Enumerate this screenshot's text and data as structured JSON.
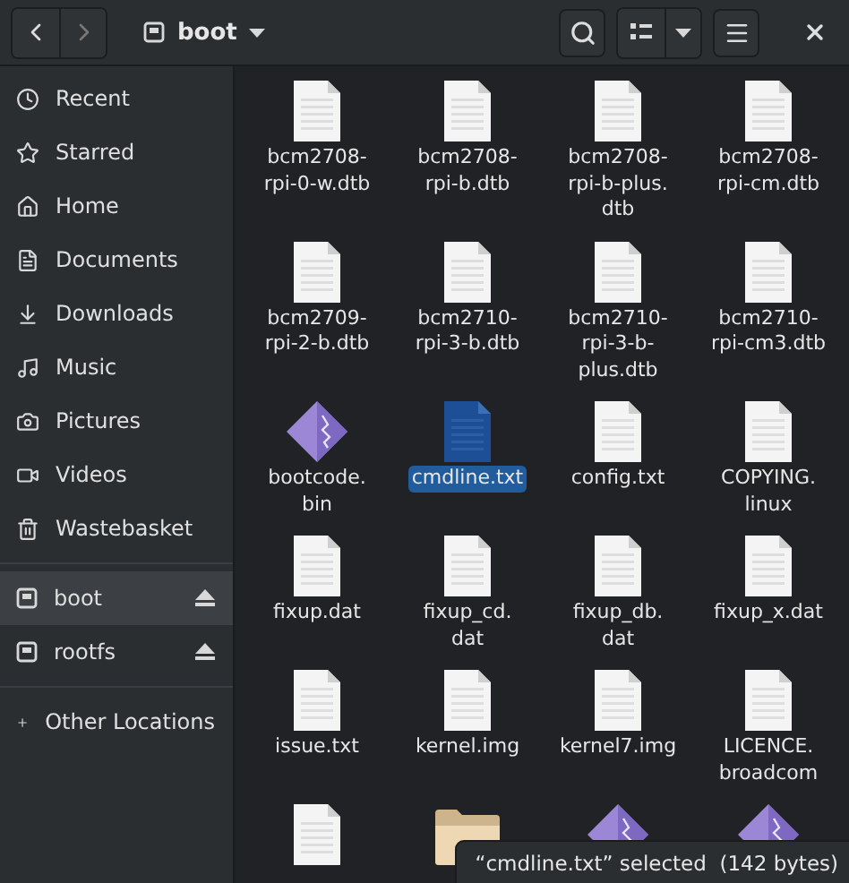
{
  "header": {
    "location": "boot"
  },
  "sidebar": {
    "places": [
      {
        "label": "Recent",
        "selected": false
      },
      {
        "label": "Starred",
        "selected": false
      },
      {
        "label": "Home",
        "selected": false
      },
      {
        "label": "Documents",
        "selected": false
      },
      {
        "label": "Downloads",
        "selected": false
      },
      {
        "label": "Music",
        "selected": false
      },
      {
        "label": "Pictures",
        "selected": false
      },
      {
        "label": "Videos",
        "selected": false
      },
      {
        "label": "Wastebasket",
        "selected": false
      }
    ],
    "devices": [
      {
        "label": "boot",
        "selected": true
      },
      {
        "label": "rootfs",
        "selected": false
      }
    ],
    "other": {
      "label": "Other Locations"
    }
  },
  "files": [
    {
      "kind": "document",
      "name": "bcm2708-\nrpi-0-w.dtb",
      "selected": false
    },
    {
      "kind": "document",
      "name": "bcm2708-\nrpi-b.dtb",
      "selected": false
    },
    {
      "kind": "document",
      "name": "bcm2708-\nrpi-b-plus.\ndtb",
      "selected": false
    },
    {
      "kind": "document",
      "name": "bcm2708-\nrpi-cm.dtb",
      "selected": false
    },
    {
      "kind": "document",
      "name": "bcm2709-\nrpi-2-b.dtb",
      "selected": false
    },
    {
      "kind": "document",
      "name": "bcm2710-\nrpi-3-b.dtb",
      "selected": false
    },
    {
      "kind": "document",
      "name": "bcm2710-\nrpi-3-b-\nplus.dtb",
      "selected": false
    },
    {
      "kind": "document",
      "name": "bcm2710-\nrpi-cm3.dtb",
      "selected": false
    },
    {
      "kind": "binary",
      "name": "bootcode.\nbin",
      "selected": false
    },
    {
      "kind": "document",
      "name": "cmdline.txt",
      "selected": true
    },
    {
      "kind": "document",
      "name": "config.txt",
      "selected": false
    },
    {
      "kind": "document",
      "name": "COPYING.\nlinux",
      "selected": false
    },
    {
      "kind": "document",
      "name": "fixup.dat",
      "selected": false
    },
    {
      "kind": "document",
      "name": "fixup_cd.\ndat",
      "selected": false
    },
    {
      "kind": "document",
      "name": "fixup_db.\ndat",
      "selected": false
    },
    {
      "kind": "document",
      "name": "fixup_x.dat",
      "selected": false
    },
    {
      "kind": "document",
      "name": "issue.txt",
      "selected": false
    },
    {
      "kind": "document",
      "name": "kernel.img",
      "selected": false
    },
    {
      "kind": "document",
      "name": "kernel7.img",
      "selected": false
    },
    {
      "kind": "document",
      "name": "LICENCE.\nbroadcom",
      "selected": false
    },
    {
      "kind": "document",
      "selected": false
    },
    {
      "kind": "folder",
      "selected": false
    },
    {
      "kind": "binary",
      "selected": false
    },
    {
      "kind": "binary",
      "selected": false
    }
  ],
  "status": "“cmdline.txt” selected  (142 bytes)"
}
